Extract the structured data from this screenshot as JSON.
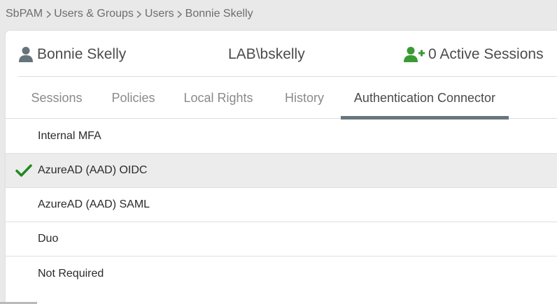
{
  "breadcrumb": {
    "items": [
      "SbPAM",
      "Users & Groups",
      "Users",
      "Bonnie Skelly"
    ]
  },
  "header": {
    "user_name": "Bonnie Skelly",
    "user_login": "LAB\\bskelly",
    "active_sessions": "0 Active Sessions"
  },
  "tabs": [
    {
      "label": "Sessions"
    },
    {
      "label": "Policies"
    },
    {
      "label": "Local Rights"
    },
    {
      "label": "History"
    },
    {
      "label": "Authentication Connector",
      "active": true
    }
  ],
  "connectors": [
    {
      "label": "Internal MFA",
      "selected": false
    },
    {
      "label": "AzureAD (AAD) OIDC",
      "selected": true
    },
    {
      "label": "AzureAD (AAD) SAML",
      "selected": false
    },
    {
      "label": "Duo",
      "selected": false
    },
    {
      "label": "Not Required",
      "selected": false
    }
  ],
  "colors": {
    "accent_green": "#3a9b35",
    "check_green": "#1e8a1e",
    "icon_gray": "#66737a",
    "tab_underline": "#68777d"
  },
  "icons": {
    "user": "user-icon",
    "sessions": "user-plus-icon",
    "selected": "checkmark-icon",
    "separator": "chevron-right-icon"
  }
}
